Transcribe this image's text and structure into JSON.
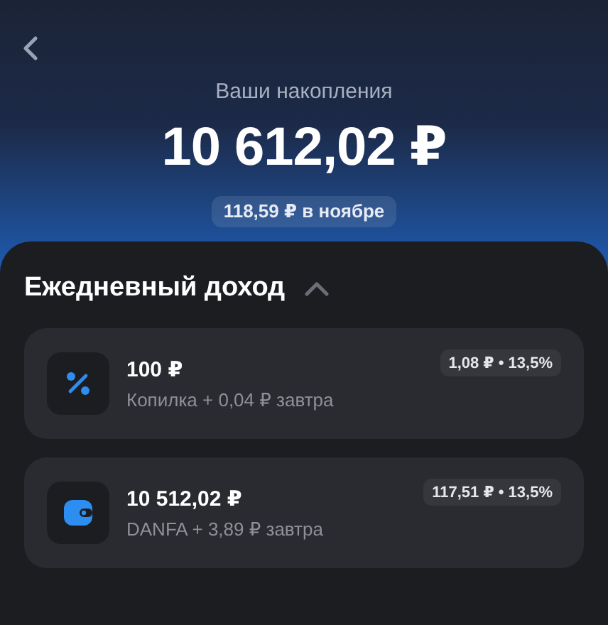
{
  "header": {
    "title": "Ваши накопления",
    "amount": "10 612,02 ₽",
    "monthly_chip": "118,59 ₽ в ноябре"
  },
  "section": {
    "title": "Ежедневный доход",
    "expanded": true
  },
  "accounts": [
    {
      "kind": "percent",
      "amount": "100 ₽",
      "subtitle": "Копилка + 0,04 ₽ завтра",
      "badge": "1,08 ₽ • 13,5%"
    },
    {
      "kind": "wallet",
      "amount": "10 512,02 ₽",
      "subtitle": "DANFA + 3,89 ₽ завтра",
      "badge": "117,51 ₽ • 13,5%"
    }
  ]
}
